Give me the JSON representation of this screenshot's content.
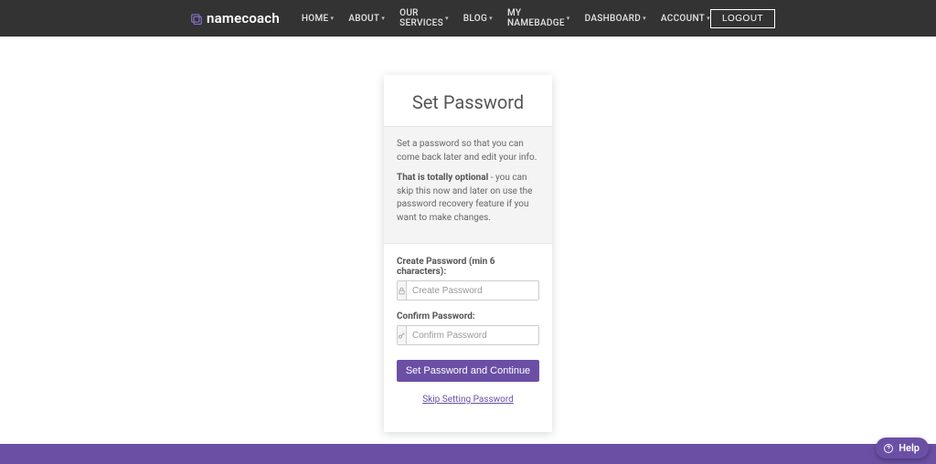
{
  "brand": {
    "name": "namecoach"
  },
  "nav": {
    "items": [
      {
        "label": "HOME"
      },
      {
        "label": "ABOUT"
      },
      {
        "label": "OUR SERVICES"
      },
      {
        "label": "BLOG"
      },
      {
        "label": "MY NAMEBADGE"
      },
      {
        "label": "DASHBOARD"
      },
      {
        "label": "ACCOUNT"
      }
    ],
    "logout": "LOGOUT"
  },
  "card": {
    "title": "Set Password",
    "info1": "Set a password so that you can come back later and edit your info.",
    "info2_bold": "That is totally optional",
    "info2_rest": " - you can skip this now and later on use the password recovery feature if you want to make changes.",
    "create_label": "Create Password (min 6 characters):",
    "create_placeholder": "Create Password",
    "confirm_label": "Confirm Password:",
    "confirm_placeholder": "Confirm Password",
    "submit": "Set Password and Continue",
    "skip": "Skip Setting Password"
  },
  "help": {
    "label": "Help"
  },
  "colors": {
    "accent": "#6b4fa5"
  }
}
